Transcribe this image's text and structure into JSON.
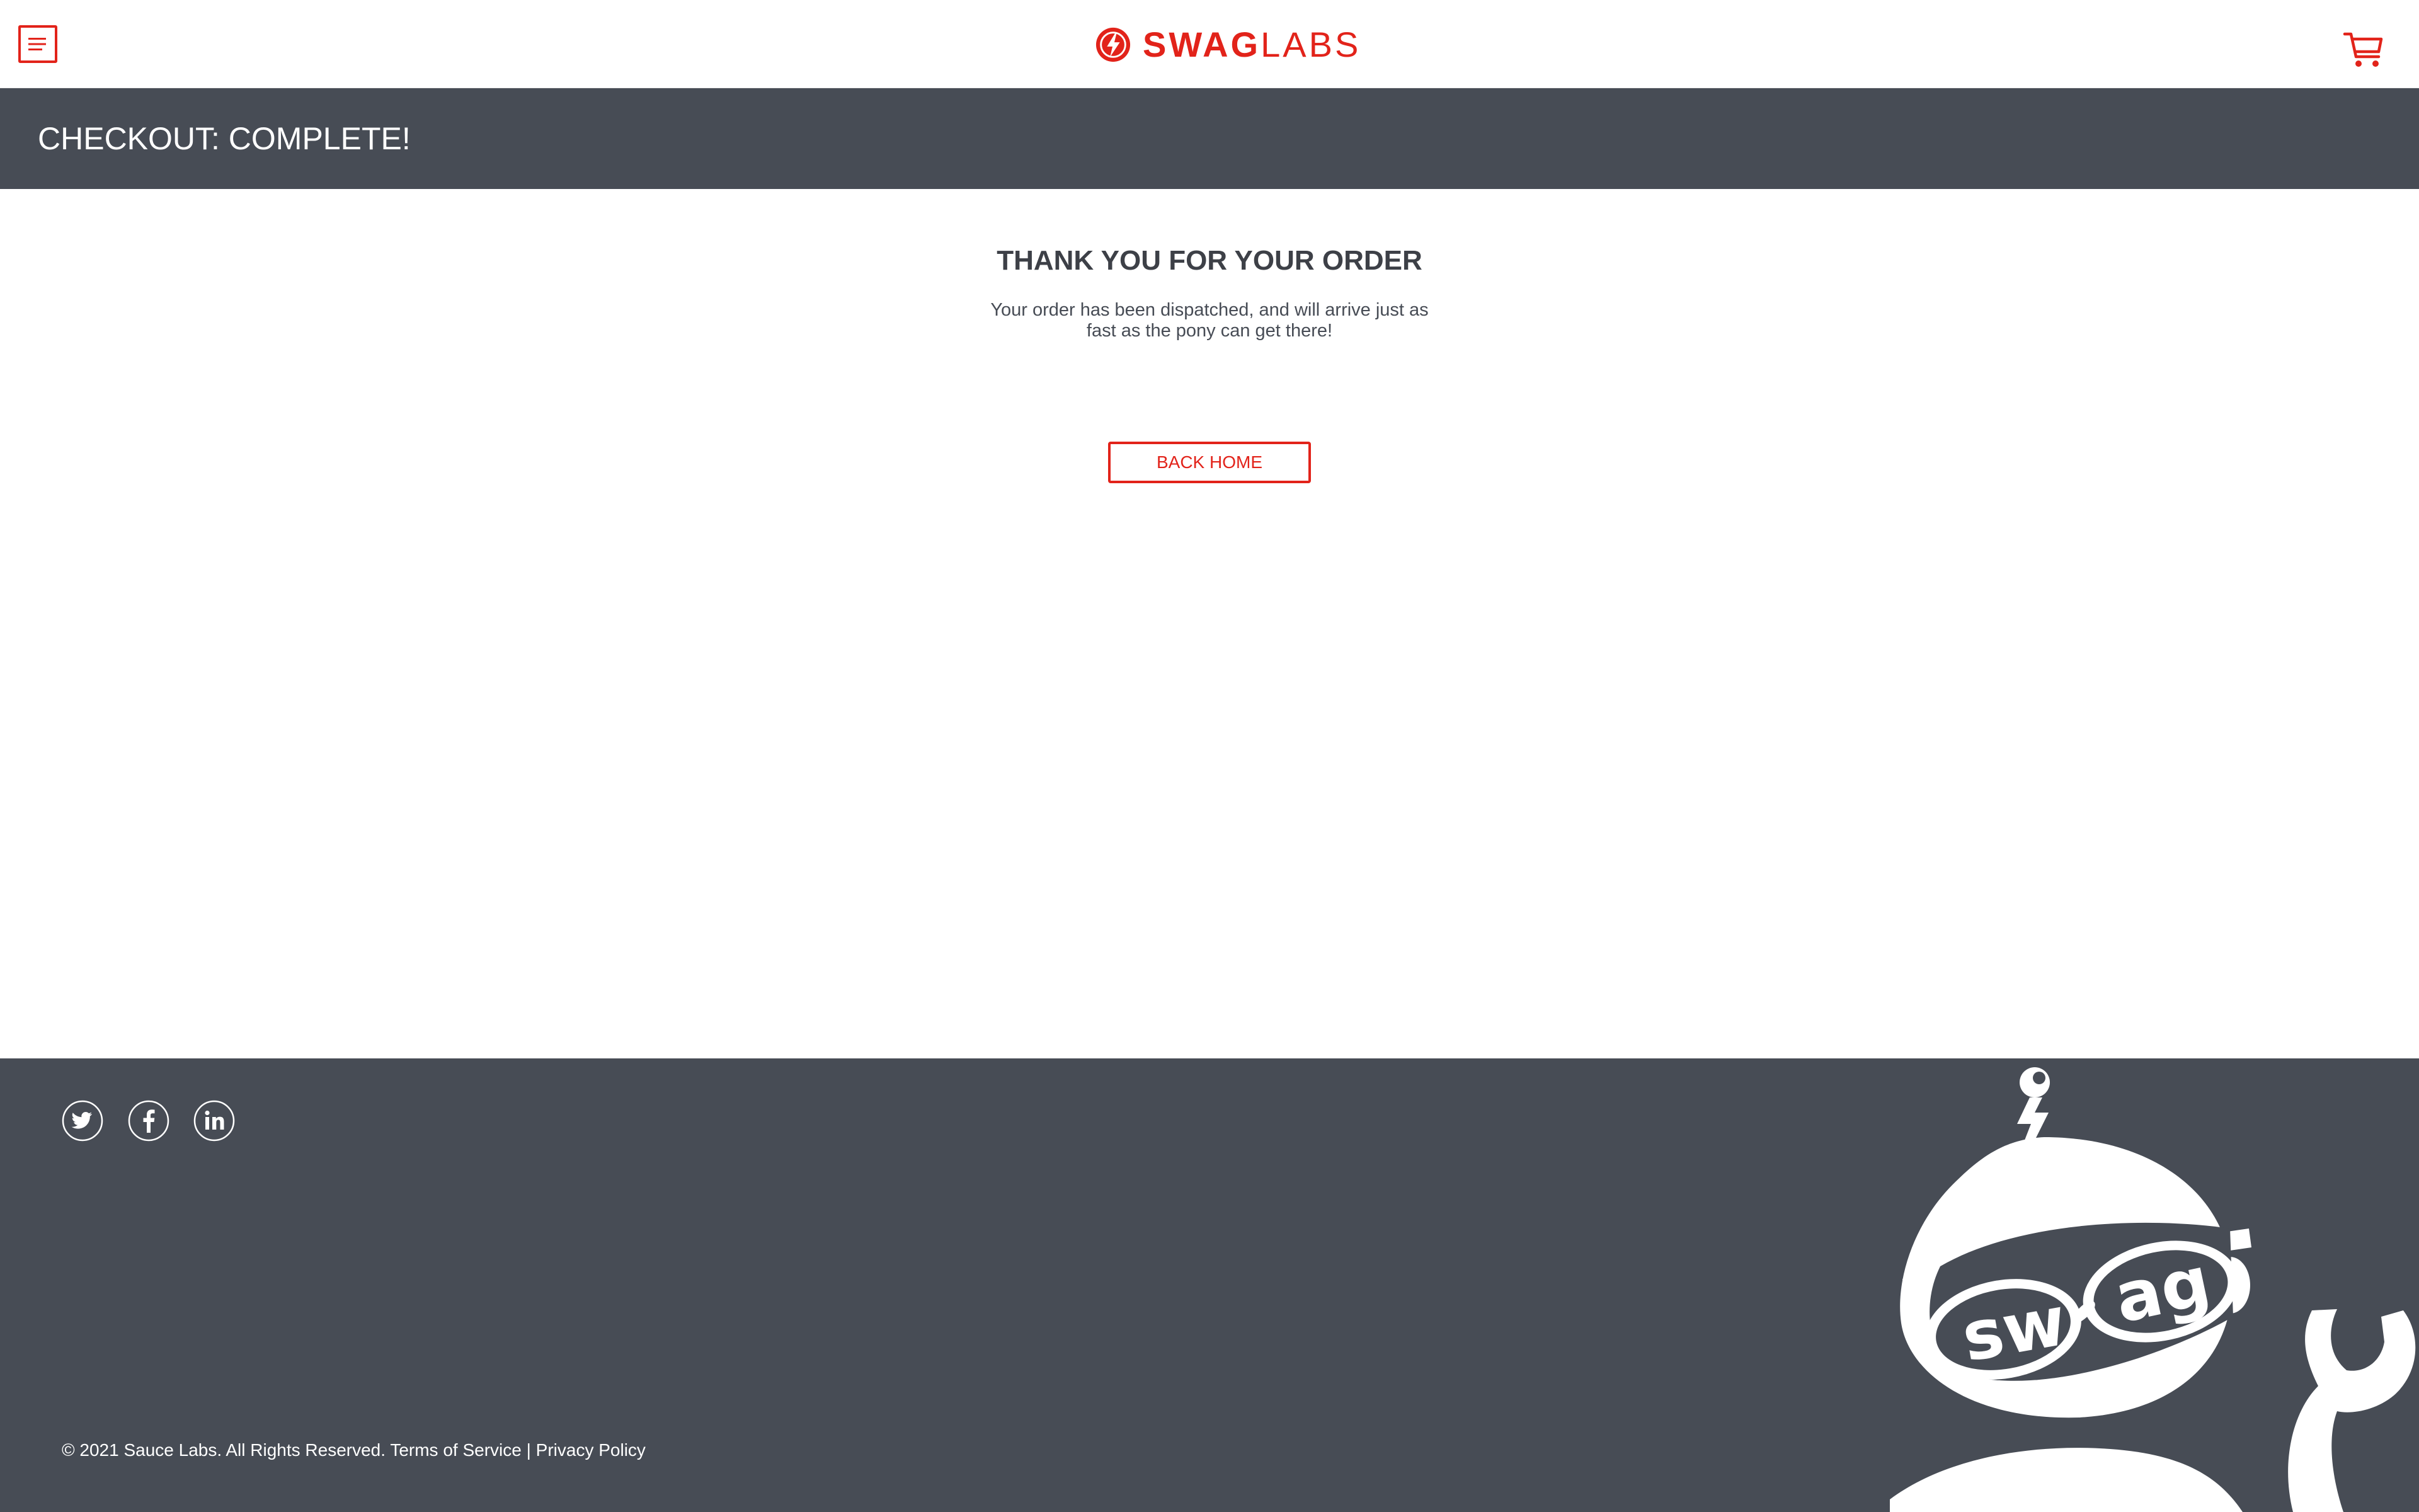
{
  "header": {
    "menu_label": "Open Menu",
    "logo": {
      "part1": "SWAG",
      "part2": "LABS"
    },
    "cart_label": "Shopping cart",
    "accent_color": "#e2231a"
  },
  "subheader": {
    "title": "CHECKOUT: COMPLETE!",
    "background": "#474c55"
  },
  "complete": {
    "header": "THANK YOU FOR YOUR ORDER",
    "text": "Your order has been dispatched, and will arrive just as fast as the pony can get there!",
    "back_button": "BACK HOME"
  },
  "footer": {
    "social": [
      "twitter-icon",
      "facebook-icon",
      "linkedin-icon"
    ],
    "copyright_prefix": "© 2021 Sauce Labs. All Rights Reserved.",
    "terms": "Terms of Service",
    "separator": "|",
    "privacy": "Privacy Policy",
    "mascot_text": {
      "left": "sw",
      "right": "ag"
    }
  }
}
